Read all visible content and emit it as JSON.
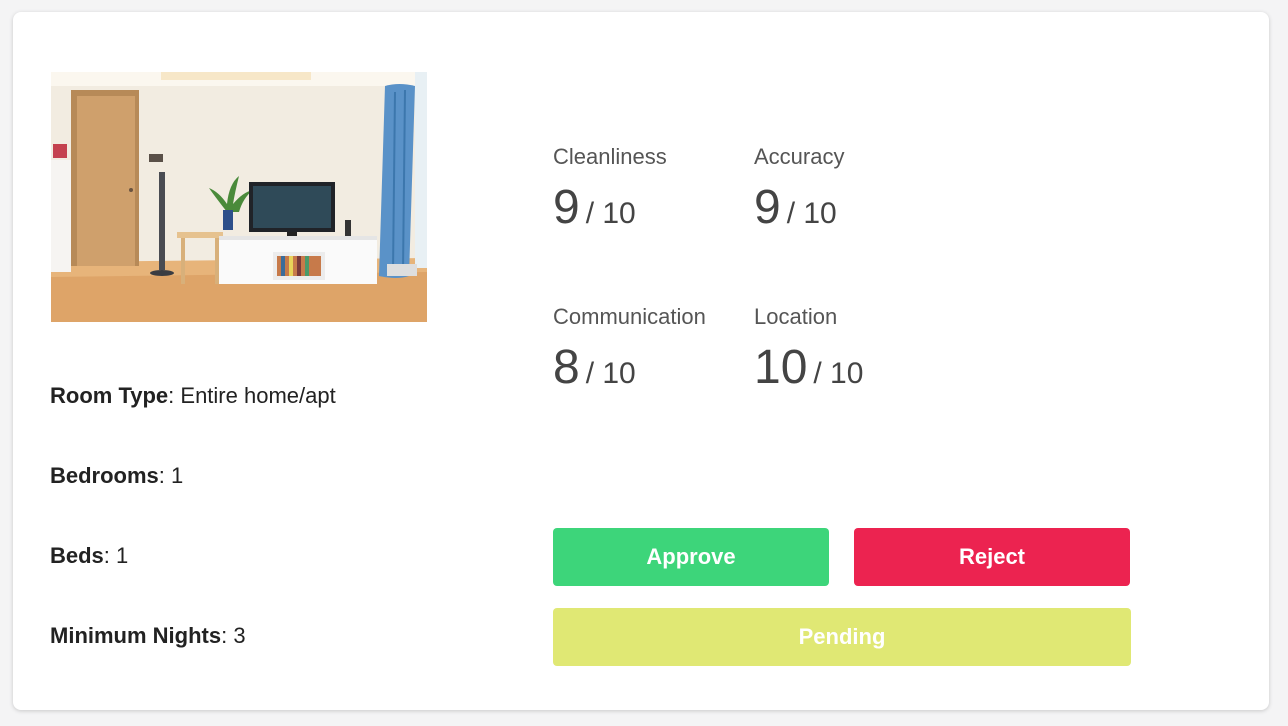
{
  "photo": {
    "icon": "living-room-photo"
  },
  "details": [
    {
      "key": "Room Type",
      "sep": ":",
      "value": " Entire home/apt"
    },
    {
      "key": "Bedrooms",
      "sep": ":",
      "value": " 1"
    },
    {
      "key": "Beds",
      "sep": ":",
      "value": " 1"
    },
    {
      "key": "Minimum Nights",
      "sep": ":",
      "value": " 3"
    }
  ],
  "ratings": [
    {
      "label": "Cleanliness",
      "score": "9",
      "max": "/ 10"
    },
    {
      "label": "Accuracy",
      "score": "9",
      "max": "/ 10"
    },
    {
      "label": "Communication",
      "score": "8",
      "max": "/ 10"
    },
    {
      "label": "Location",
      "score": "10",
      "max": "/ 10"
    }
  ],
  "actions": {
    "approve": "Approve",
    "reject": "Reject",
    "pending": "Pending"
  },
  "colors": {
    "approve": "#3dd57a",
    "reject": "#ec2350",
    "pending": "#e0e874"
  }
}
